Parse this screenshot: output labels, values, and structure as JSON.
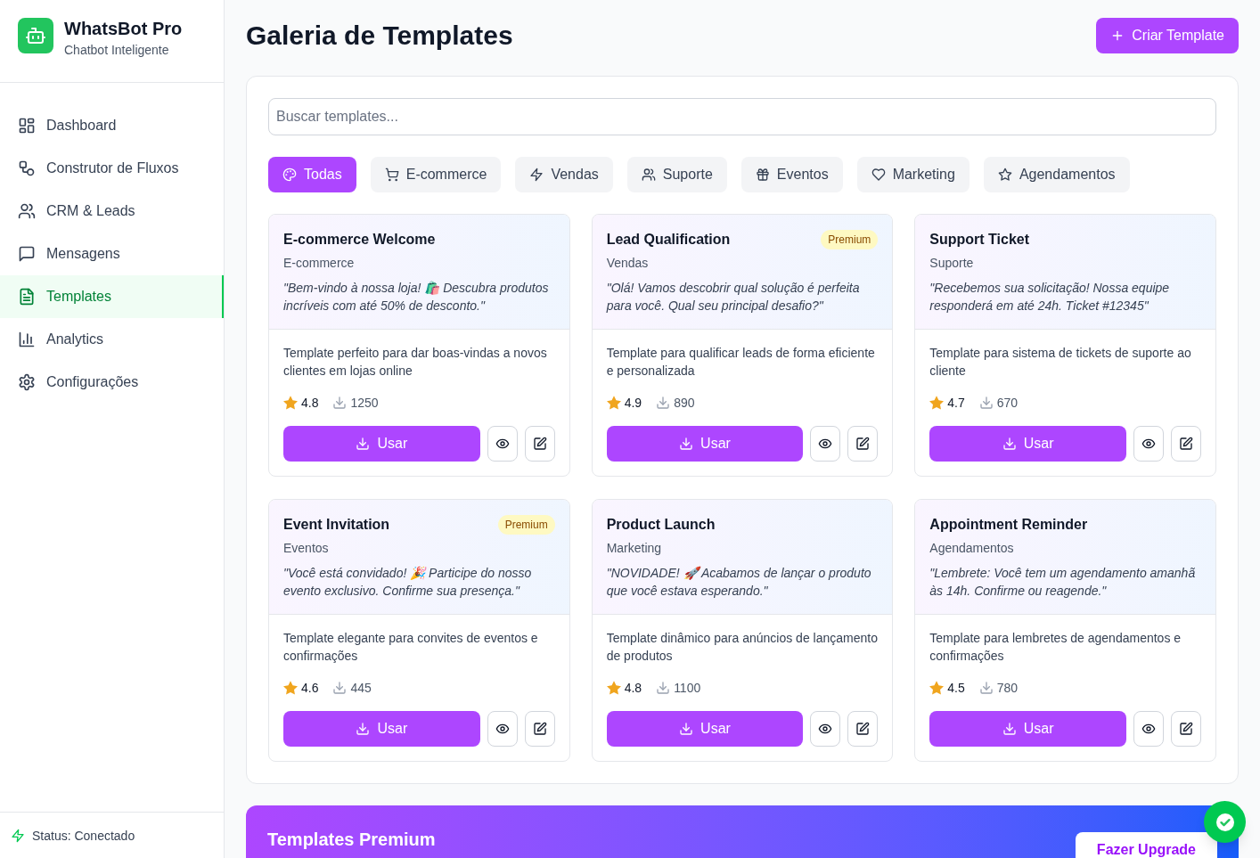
{
  "sidebar": {
    "brand": {
      "name": "WhatsBot Pro",
      "tagline": "Chatbot Inteligente"
    },
    "items": [
      {
        "label": "Dashboard",
        "selected": false
      },
      {
        "label": "Construtor de Fluxos",
        "selected": false
      },
      {
        "label": "CRM & Leads",
        "selected": false
      },
      {
        "label": "Mensagens",
        "selected": false
      },
      {
        "label": "Templates",
        "selected": true
      },
      {
        "label": "Analytics",
        "selected": false
      },
      {
        "label": "Configurações",
        "selected": false
      }
    ],
    "status": "Status: Conectado"
  },
  "header": {
    "title": "Galeria de Templates",
    "button": "Criar Template"
  },
  "search": {
    "placeholder": "Buscar templates..."
  },
  "filters": [
    {
      "label": "Todas",
      "selected": true
    },
    {
      "label": "E-commerce",
      "selected": false
    },
    {
      "label": "Vendas",
      "selected": false
    },
    {
      "label": "Suporte",
      "selected": false
    },
    {
      "label": "Eventos",
      "selected": false
    },
    {
      "label": "Marketing",
      "selected": false
    },
    {
      "label": "Agendamentos",
      "selected": false
    }
  ],
  "templates": [
    {
      "title": "E-commerce Welcome",
      "category": "E-commerce",
      "quote": "\"Bem-vindo à nossa loja! 🛍️ Descubra produtos incríveis com até 50% de desconto.\"",
      "description": "Template perfeito para dar boas-vindas a novos clientes em lojas online",
      "rating": "4.8",
      "downloads": "1250",
      "button": "Usar"
    },
    {
      "title": "Lead Qualification",
      "badge": "Premium",
      "category": "Vendas",
      "quote": "\"Olá! Vamos descobrir qual solução é perfeita para você. Qual seu principal desafio?\"",
      "description": "Template para qualificar leads de forma eficiente e personalizada",
      "rating": "4.9",
      "downloads": "890",
      "button": "Usar"
    },
    {
      "title": "Support Ticket",
      "category": "Suporte",
      "quote": "\"Recebemos sua solicitação! Nossa equipe responderá em até 24h. Ticket #12345\"",
      "description": "Template para sistema de tickets de suporte ao cliente",
      "rating": "4.7",
      "downloads": "670",
      "button": "Usar"
    },
    {
      "title": "Event Invitation",
      "badge": "Premium",
      "category": "Eventos",
      "quote": "\"Você está convidado! 🎉 Participe do nosso evento exclusivo. Confirme sua presença.\"",
      "description": "Template elegante para convites de eventos e confirmações",
      "rating": "4.6",
      "downloads": "445",
      "button": "Usar"
    },
    {
      "title": "Product Launch",
      "category": "Marketing",
      "quote": "\"NOVIDADE! 🚀 Acabamos de lançar o produto que você estava esperando.\"",
      "description": "Template dinâmico para anúncios de lançamento de produtos",
      "rating": "4.8",
      "downloads": "1100",
      "button": "Usar"
    },
    {
      "title": "Appointment Reminder",
      "category": "Agendamentos",
      "quote": "\"Lembrete: Você tem um agendamento amanhã às 14h. Confirme ou reagende.\"",
      "description": "Template para lembretes de agendamentos e confirmações",
      "rating": "4.5",
      "downloads": "780",
      "button": "Usar"
    }
  ],
  "premium_banner": {
    "title": "Templates Premium",
    "button": "Fazer Upgrade"
  }
}
